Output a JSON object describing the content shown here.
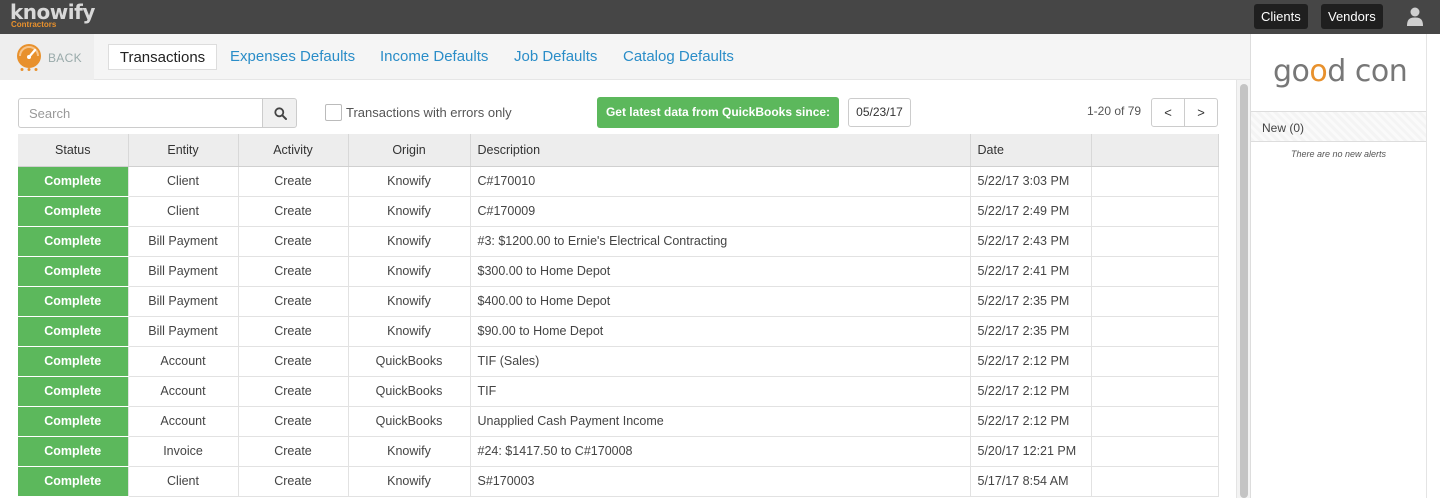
{
  "header": {
    "logo_text": "knowify",
    "logo_subtext": "Contractors",
    "clients_label": "Clients",
    "vendors_label": "Vendors"
  },
  "subnav": {
    "back_label": "BACK",
    "tabs": [
      {
        "label": "Transactions"
      },
      {
        "label": "Expenses Defaults"
      },
      {
        "label": "Income Defaults"
      },
      {
        "label": "Job Defaults"
      },
      {
        "label": "Catalog Defaults"
      }
    ]
  },
  "toolbar": {
    "search_placeholder": "Search",
    "errors_only_label": "Transactions with errors only",
    "qb_button_label": "Get latest data from QuickBooks since:",
    "since_date": "05/23/17",
    "paging_text": "1-20 of 79",
    "prev_label": "<",
    "next_label": ">"
  },
  "table": {
    "columns": [
      "Status",
      "Entity",
      "Activity",
      "Origin",
      "Description",
      "Date"
    ],
    "rows": [
      {
        "status": "Complete",
        "entity": "Client",
        "activity": "Create",
        "origin": "Knowify",
        "description": "C#170010",
        "date": "5/22/17 3:03 PM"
      },
      {
        "status": "Complete",
        "entity": "Client",
        "activity": "Create",
        "origin": "Knowify",
        "description": "C#170009",
        "date": "5/22/17 2:49 PM"
      },
      {
        "status": "Complete",
        "entity": "Bill Payment",
        "activity": "Create",
        "origin": "Knowify",
        "description": "#3: $1200.00 to Ernie's Electrical Contracting",
        "date": "5/22/17 2:43 PM"
      },
      {
        "status": "Complete",
        "entity": "Bill Payment",
        "activity": "Create",
        "origin": "Knowify",
        "description": "$300.00 to Home Depot",
        "date": "5/22/17 2:41 PM"
      },
      {
        "status": "Complete",
        "entity": "Bill Payment",
        "activity": "Create",
        "origin": "Knowify",
        "description": "$400.00 to Home Depot",
        "date": "5/22/17 2:35 PM"
      },
      {
        "status": "Complete",
        "entity": "Bill Payment",
        "activity": "Create",
        "origin": "Knowify",
        "description": "$90.00 to Home Depot",
        "date": "5/22/17 2:35 PM"
      },
      {
        "status": "Complete",
        "entity": "Account",
        "activity": "Create",
        "origin": "QuickBooks",
        "description": "TIF (Sales)",
        "date": "5/22/17 2:12 PM"
      },
      {
        "status": "Complete",
        "entity": "Account",
        "activity": "Create",
        "origin": "QuickBooks",
        "description": "TIF",
        "date": "5/22/17 2:12 PM"
      },
      {
        "status": "Complete",
        "entity": "Account",
        "activity": "Create",
        "origin": "QuickBooks",
        "description": "Unapplied Cash Payment Income",
        "date": "5/22/17 2:12 PM"
      },
      {
        "status": "Complete",
        "entity": "Invoice",
        "activity": "Create",
        "origin": "Knowify",
        "description": "#24: $1417.50 to C#170008",
        "date": "5/20/17 12:21 PM"
      },
      {
        "status": "Complete",
        "entity": "Client",
        "activity": "Create",
        "origin": "Knowify",
        "description": "S#170003",
        "date": "5/17/17 8:54 AM"
      }
    ]
  },
  "right_panel": {
    "brand_left": "go",
    "brand_mid": "o",
    "brand_rest": "d con",
    "alerts_tab_label": "New (0)",
    "alerts_empty_text": "There are no new alerts"
  },
  "colors": {
    "topbar": "#464646",
    "accent_orange": "#e8912d",
    "link_blue": "#2a8dc8",
    "status_green": "#5cb85c"
  },
  "icons": [
    "gauge-icon",
    "search-icon",
    "user-icon"
  ]
}
